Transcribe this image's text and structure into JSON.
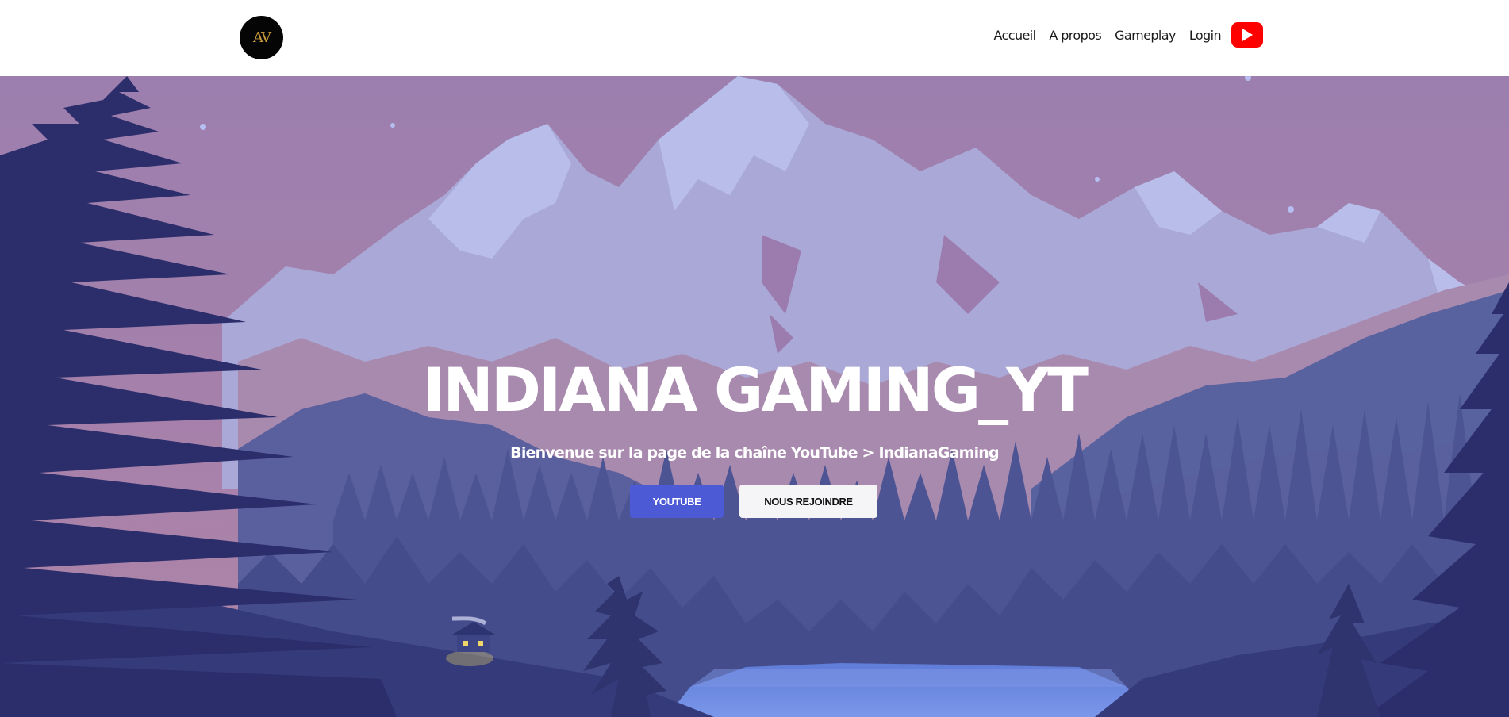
{
  "header": {
    "logo_text": "AV",
    "nav": {
      "home": "Accueil",
      "about": "A propos",
      "gameplay": "Gameplay",
      "login": "Login"
    },
    "youtube_icon": "youtube-play-icon"
  },
  "hero": {
    "title": "INDIANA GAMING_YT",
    "subtitle": "Bienvenue sur la page de la chaîne YouTube > IndianaGaming",
    "youtube_button": "YOUTUBE",
    "join_button": "NOUS REJOINDRE"
  },
  "colors": {
    "youtube_red": "#ff0000",
    "primary_button": "#4c5ad6",
    "sky": "#a680ab",
    "forest_dark": "#2b2e6b",
    "lake": "#6a86e0"
  }
}
